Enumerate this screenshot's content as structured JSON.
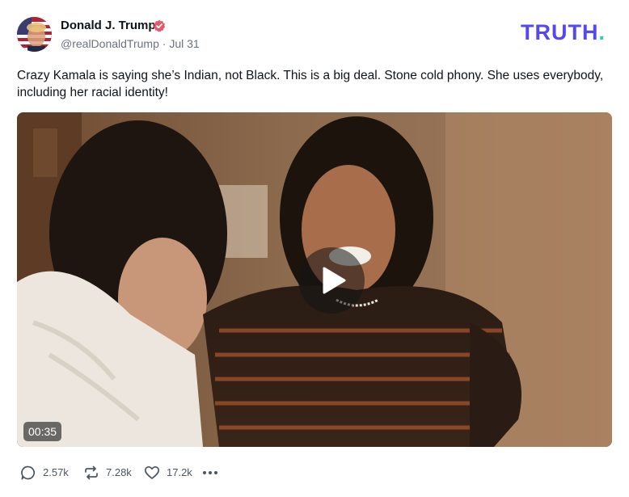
{
  "post": {
    "author": {
      "display_name": "Donald J. Trump",
      "handle": "@realDonaldTrump",
      "separator": "·",
      "date": "Jul 31",
      "verified": true,
      "avatar": "avatar-flag-portrait"
    },
    "brand": {
      "name": "TRUTH",
      "dot": ".",
      "color": "#5448ee",
      "dot_color": "#22d3b0"
    },
    "text": "Crazy Kamala is saying she’s Indian, not Black. This is a big deal. Stone cold phony. She uses everybody, including her racial identity!",
    "media": {
      "type": "video",
      "duration": "00:35",
      "play_icon": "play-icon"
    },
    "actions": {
      "replies": {
        "icon": "reply-icon",
        "count": "2.57k"
      },
      "reposts": {
        "icon": "repost-icon",
        "count": "7.28k"
      },
      "likes": {
        "icon": "heart-icon",
        "count": "17.2k"
      },
      "more": {
        "icon": "more-icon"
      }
    }
  }
}
